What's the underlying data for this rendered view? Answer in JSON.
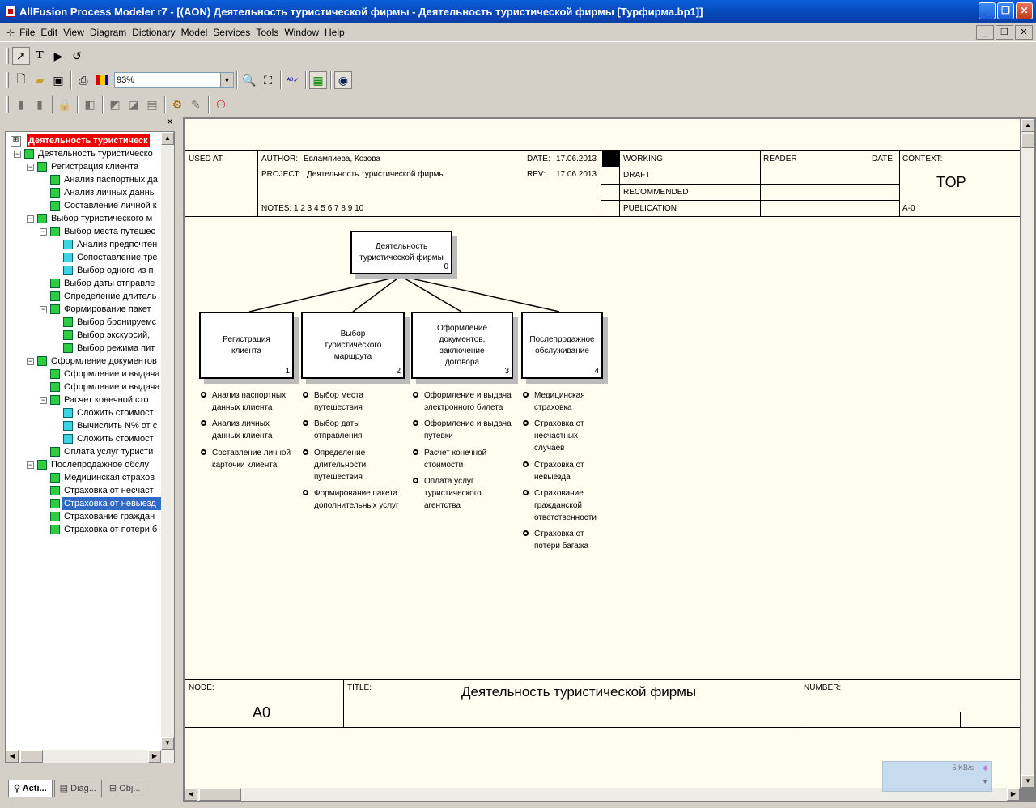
{
  "window": {
    "title": "AllFusion Process Modeler r7 - [(AON) Деятельность туристической фирмы - Деятельность туристической фирмы  [Турфирма.bp1]]"
  },
  "menu": [
    "File",
    "Edit",
    "View",
    "Diagram",
    "Dictionary",
    "Model",
    "Services",
    "Tools",
    "Window",
    "Help"
  ],
  "toolbar": {
    "zoom": "93%"
  },
  "tree": {
    "items": [
      {
        "label": "Деятельность туристическ",
        "depth": 0,
        "style": "root"
      },
      {
        "label": "Деятельность туристическо",
        "depth": 1,
        "icon": "green",
        "expand": "-"
      },
      {
        "label": "Регистрация клиента",
        "depth": 2,
        "icon": "green",
        "expand": "-"
      },
      {
        "label": "Анализ паспортных да",
        "depth": 3,
        "icon": "green"
      },
      {
        "label": "Анализ личных данны",
        "depth": 3,
        "icon": "green"
      },
      {
        "label": "Составление личной к",
        "depth": 3,
        "icon": "green"
      },
      {
        "label": "Выбор туристического м",
        "depth": 2,
        "icon": "green",
        "expand": "-"
      },
      {
        "label": "Выбор места путешес",
        "depth": 3,
        "icon": "green",
        "expand": "-"
      },
      {
        "label": "Анализ предпочтен",
        "depth": 4,
        "icon": "cyan"
      },
      {
        "label": "Сопоставление тре",
        "depth": 4,
        "icon": "cyan"
      },
      {
        "label": "Выбор одного из п",
        "depth": 4,
        "icon": "cyan"
      },
      {
        "label": "Выбор даты отправле",
        "depth": 3,
        "icon": "green"
      },
      {
        "label": "Определение длитель",
        "depth": 3,
        "icon": "green"
      },
      {
        "label": "Формирование пакет",
        "depth": 3,
        "icon": "green",
        "expand": "-"
      },
      {
        "label": "Выбор бронируемс",
        "depth": 4,
        "icon": "green"
      },
      {
        "label": "Выбор экскурсий,",
        "depth": 4,
        "icon": "green"
      },
      {
        "label": "Выбор режима пит",
        "depth": 4,
        "icon": "green"
      },
      {
        "label": "Оформление документов",
        "depth": 2,
        "icon": "green",
        "expand": "-"
      },
      {
        "label": "Оформление и выдача",
        "depth": 3,
        "icon": "green"
      },
      {
        "label": "Оформление и выдача",
        "depth": 3,
        "icon": "green"
      },
      {
        "label": "Расчет конечной сто",
        "depth": 3,
        "icon": "green",
        "expand": "-"
      },
      {
        "label": "Сложить стоимост",
        "depth": 4,
        "icon": "cyan"
      },
      {
        "label": "Вычислить N% от с",
        "depth": 4,
        "icon": "cyan"
      },
      {
        "label": "Сложить стоимост",
        "depth": 4,
        "icon": "cyan"
      },
      {
        "label": "Оплата услуг туристи",
        "depth": 3,
        "icon": "green"
      },
      {
        "label": "Послепродажное обслу",
        "depth": 2,
        "icon": "green",
        "expand": "-"
      },
      {
        "label": "Медицинская страхов",
        "depth": 3,
        "icon": "green"
      },
      {
        "label": "Страховка от несчаст",
        "depth": 3,
        "icon": "green"
      },
      {
        "label": "Страховка от невыезд",
        "depth": 3,
        "icon": "green",
        "style": "selected"
      },
      {
        "label": "Страхование граждан",
        "depth": 3,
        "icon": "green"
      },
      {
        "label": "Страховка от потери б",
        "depth": 3,
        "icon": "green"
      }
    ],
    "tabs": [
      "Acti...",
      "Diag...",
      "Obj..."
    ]
  },
  "header": {
    "used_at": "USED AT:",
    "author_label": "AUTHOR:",
    "author": "Евлампиева, Козова",
    "project_label": "PROJECT:",
    "project": "Деятельность туристической фирмы",
    "date_label": "DATE:",
    "date": "17.06.2013",
    "rev_label": "REV:",
    "rev": "17.06.2013",
    "notes": "NOTES:  1  2  3  4  5  6  7  8  9  10",
    "statuses": [
      "WORKING",
      "DRAFT",
      "RECOMMENDED",
      "PUBLICATION"
    ],
    "reader": "READER",
    "reader_date": "DATE",
    "context": "CONTEXT:",
    "top": "TOP",
    "a0": "A-0"
  },
  "diagram": {
    "root": {
      "text": "Деятельность\nтуристической фирмы",
      "num": "0"
    },
    "children": [
      {
        "text": "Регистрация\nклиента",
        "num": "1",
        "subs": [
          "Анализ паспортных\nданных клиента",
          "Анализ личных\nданных клиента",
          "Составление личной\nкарточки клиента"
        ]
      },
      {
        "text": "Выбор\nтуристического\nмаршрута",
        "num": "2",
        "subs": [
          "Выбор места\nпутешествия",
          "Выбор даты\nотправления",
          "Определение\nдлительности\nпутешествия",
          "Формирование пакета\nдополнительных услуг"
        ]
      },
      {
        "text": "Оформление\nдокументов,\nзаключение\nдоговора",
        "num": "3",
        "subs": [
          "Оформление и выдача\nэлектронного билета",
          "Оформление и выдача\nпутевки",
          "Расчет конечной\nстоимости",
          "Оплата услуг\nтуристического\nагентства"
        ]
      },
      {
        "text": "Послепродажное\nобслуживание",
        "num": "4",
        "subs": [
          "Медицинская\nстраховка",
          "Страховка от\nнесчастных\nслучаев",
          "Страховка от\nневыезда",
          "Страхование\nгражданской\nответственности",
          "Страховка от\nпотери багажа"
        ]
      }
    ]
  },
  "footer": {
    "node_label": "NODE:",
    "node": "A0",
    "title_label": "TITLE:",
    "title": "Деятельность туристической фирмы",
    "number_label": "NUMBER:"
  },
  "net": {
    "speed": "5 KB/s"
  }
}
